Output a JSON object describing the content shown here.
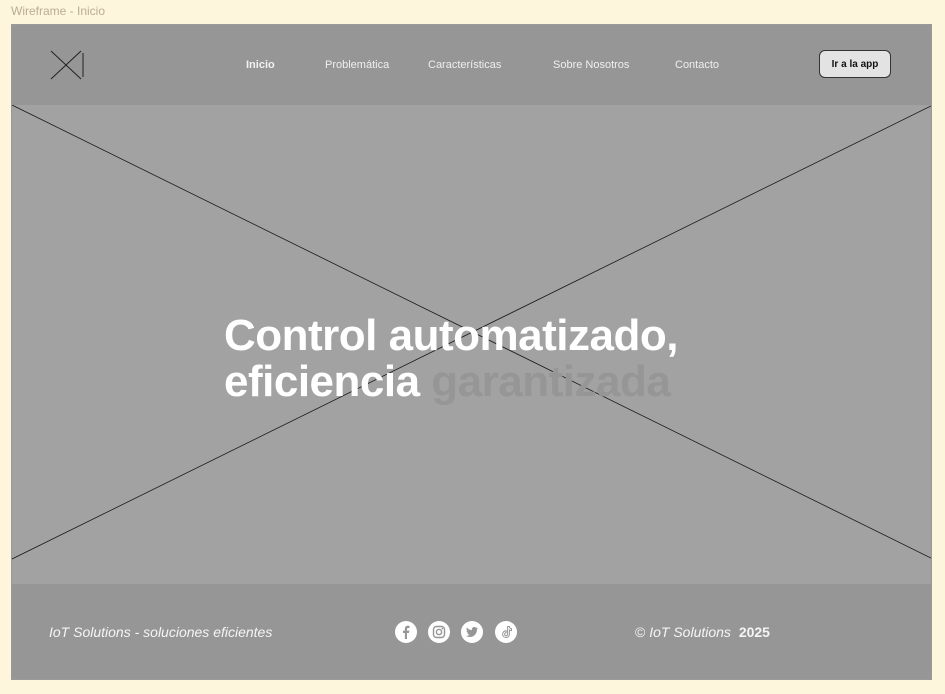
{
  "frame_label": "Wireframe - Inicio",
  "nav": {
    "links": [
      "Inicio",
      "Problemática",
      "Características",
      "Sobre Nosotros",
      "Contacto"
    ],
    "cta": "Ir a la app"
  },
  "hero": {
    "line1": "Control automatizado,",
    "line2_main": "eficiencia",
    "line2_muted": "garantizada"
  },
  "footer": {
    "tagline": "IoT Solutions - soluciones eficientes",
    "social_icons": [
      "facebook-icon",
      "instagram-icon",
      "twitter-icon",
      "tiktok-icon"
    ],
    "copyright_symbol": "©",
    "copyright_brand": "IoT Solutions",
    "copyright_year": "2025"
  },
  "colors": {
    "page_background": "#fdf5dc",
    "navbar": "#969696",
    "hero": "#a2a2a2",
    "hero_text": "#ffffff",
    "hero_muted": "#969696",
    "button": "#e3e3e3"
  }
}
